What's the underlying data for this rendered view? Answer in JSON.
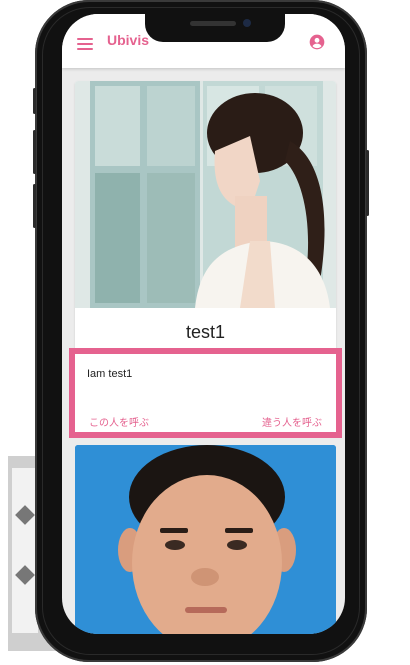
{
  "app": {
    "title": "Ubivis"
  },
  "icons": {
    "menu": "hamburger-menu-icon",
    "account": "account-circle-icon"
  },
  "colors": {
    "accent": "#e5628f",
    "card2_background": "#2f8fd6"
  },
  "profile_card": {
    "name": "test1"
  },
  "message_box": {
    "text": "Iam test1",
    "call_this_person_label": "この人を呼ぶ",
    "call_other_person_label": "違う人を呼ぶ"
  }
}
